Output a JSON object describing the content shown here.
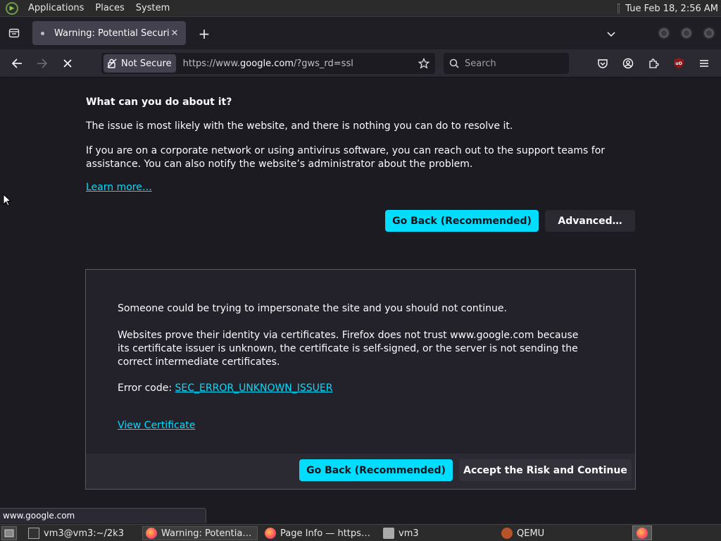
{
  "system_panel": {
    "menus": [
      "Applications",
      "Places",
      "System"
    ],
    "clock": "Tue Feb 18,  2:56 AM"
  },
  "tab": {
    "title": "Warning: Potential Security Risk Ahead",
    "close": "✕",
    "new_tab": "+"
  },
  "urlbar": {
    "security_label": "Not Secure",
    "url_prefix": "https://www.",
    "url_host": "google.com",
    "url_suffix": "/?gws_rd=ssl",
    "search_placeholder": "Search"
  },
  "content": {
    "heading": "What can you do about it?",
    "para1": "The issue is most likely with the website, and there is nothing you can do to resolve it.",
    "para2": "If you are on a corporate network or using antivirus software, you can reach out to the support teams for assistance. You can also notify the website’s administrator about the problem.",
    "learn_more": "Learn more…",
    "go_back": "Go Back (Recommended)",
    "advanced": "Advanced…"
  },
  "advanced_panel": {
    "para1": "Someone could be trying to impersonate the site and you should not continue.",
    "para2": "Websites prove their identity via certificates. Firefox does not trust www.google.com because its certificate issuer is unknown, the certificate is self-signed, or the server is not sending the correct intermediate certificates.",
    "error_label": "Error code: ",
    "error_code": "SEC_ERROR_UNKNOWN_ISSUER",
    "view_certificate": "View Certificate",
    "go_back": "Go Back (Recommended)",
    "accept": "Accept the Risk and Continue"
  },
  "status_url": "www.google.com",
  "taskbar": {
    "items": [
      "vm3@vm3:~/2k3",
      "Warning: Potential Security Risk Ahead",
      "Page Info — https://www.google.com",
      "vm3",
      "QEMU"
    ]
  },
  "colors": {
    "accent": "#00ddff",
    "background": "#1c1b22",
    "toolbar": "#2b2a33"
  }
}
